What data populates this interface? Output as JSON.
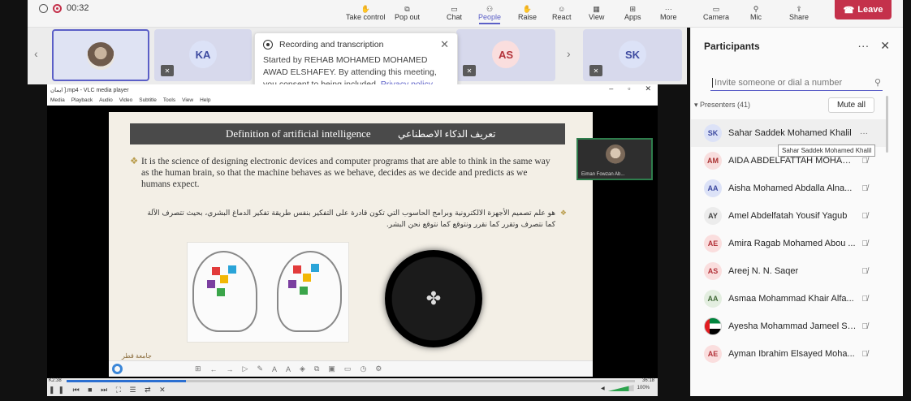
{
  "toolbar": {
    "timer": "00:32",
    "buttons": [
      {
        "label": "Take control",
        "icon": "hand-icon"
      },
      {
        "label": "Pop out",
        "icon": "popout-icon"
      },
      {
        "label": "Chat",
        "icon": "chat-icon"
      },
      {
        "label": "People",
        "icon": "people-icon"
      },
      {
        "label": "Raise",
        "icon": "raise-hand-icon"
      },
      {
        "label": "React",
        "icon": "react-icon"
      },
      {
        "label": "View",
        "icon": "view-icon"
      },
      {
        "label": "Apps",
        "icon": "apps-icon"
      },
      {
        "label": "More",
        "icon": "more-icon"
      },
      {
        "label": "Camera",
        "icon": "camera-icon"
      },
      {
        "label": "Mic",
        "icon": "mic-icon"
      },
      {
        "label": "Share",
        "icon": "share-icon"
      }
    ],
    "leave_label": "Leave",
    "accent": "#5b5fc7",
    "leave_color": "#c4314b"
  },
  "strip": {
    "tiles": [
      {
        "initials": "",
        "photo": true
      },
      {
        "initials": "KA"
      },
      {
        "initials": "AS"
      },
      {
        "initials": "SK"
      }
    ]
  },
  "popup": {
    "title": "Recording and transcription",
    "body": "Started by REHAB MOHAMED MOHAMED AWAD ELSHAFEY. By attending this meeting, you consent to being included.",
    "link": "Privacy policy"
  },
  "vlc": {
    "title": "ايمان ].mp4 - VLC media player",
    "menu": [
      "Media",
      "Playback",
      "Audio",
      "Video",
      "Subtitle",
      "Tools",
      "View",
      "Help"
    ],
    "time_elapsed": "K2:38",
    "time_total": "36:18",
    "volume": "100%",
    "progress": 0.21
  },
  "slide": {
    "title_en": "Definition of artificial intelligence",
    "title_ar": "تعريف الذكاء الاصطناعي",
    "bullet_en": "It is the science of designing electronic devices and computer programs that are able to think in the same way as the human brain, so that the machine behaves as we behave, decides as we decide and predicts as we humans expect.",
    "bullet_ar": "هو علم تصميم الأجهزة الالكترونية وبرامج الحاسوب التي تكون قادرة على التفكير بنفس طريقة تفكير الدماغ البشري، بحيث تتصرف الآلة كما نتصرف وتقرر كما نقرر ونتوقع كما نتوقع نحن البشر.",
    "logo_text": "جامعة قطر",
    "speaker_name": "Eiman Fowzan Ab..."
  },
  "participants": {
    "title": "Participants",
    "invite_placeholder": "Invite someone or dial a number",
    "presenters_label": "Presenters (41)",
    "mute_all": "Mute all",
    "tooltip": "Sahar Saddek Mohamed  Khalil",
    "people": [
      {
        "initials": "SK",
        "name": "Sahar Saddek Mohamed Khalil",
        "color": "#dce2f7",
        "text_color": "#3d4aa0"
      },
      {
        "initials": "AM",
        "name": "AIDA ABDELFATTAH MOHAMED",
        "color": "#f8dede",
        "text_color": "#a33"
      },
      {
        "initials": "AA",
        "name": "Aisha Mohamed Abdalla Alna...",
        "color": "#dce2f7",
        "text_color": "#3d4aa0"
      },
      {
        "initials": "AY",
        "name": "Amel Abdelfatah Yousif Yagub",
        "color": "#ececec",
        "text_color": "#444"
      },
      {
        "initials": "AE",
        "name": "Amira Ragab Mohamed Abou ...",
        "color": "#fadede",
        "text_color": "#b3333a"
      },
      {
        "initials": "AS",
        "name": "Areej N. N. Saqer",
        "color": "#fadede",
        "text_color": "#b3333a"
      },
      {
        "initials": "AA",
        "name": "Asmaa Mohammad Khair Alfa...",
        "color": "#e3eee0",
        "text_color": "#446b3a"
      },
      {
        "initials": "",
        "name": "Ayesha Mohammad Jameel Sa...",
        "color": "flag",
        "text_color": ""
      },
      {
        "initials": "AE",
        "name": "Ayman Ibrahim Elsayed Moha...",
        "color": "#fadede",
        "text_color": "#b3333a"
      }
    ]
  }
}
